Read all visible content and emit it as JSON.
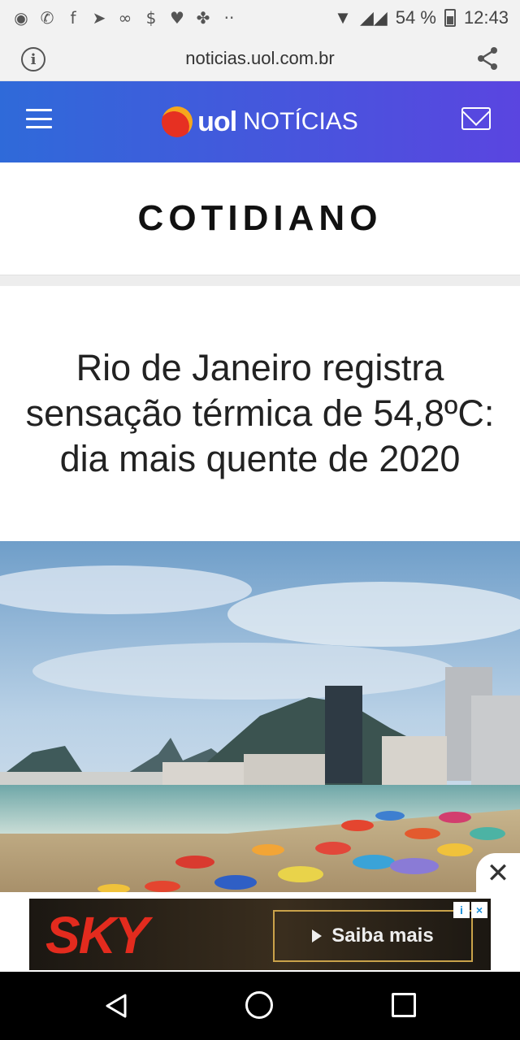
{
  "status_bar": {
    "notification_icons": [
      "chrome-icon",
      "whatsapp-icon",
      "facebook-icon",
      "telegram-icon",
      "cc-icon",
      "dollar-icon",
      "heart-icon",
      "puzzle-icon",
      "more-dots-icon"
    ],
    "battery": "54 %",
    "time": "12:43"
  },
  "url_bar": {
    "url": "noticias.uol.com.br"
  },
  "header": {
    "brand": "uol",
    "section": "NOTÍCIAS",
    "colors": {
      "gradient_start": "#2f6ad9",
      "gradient_end": "#5a45e0"
    }
  },
  "section": {
    "title": "COTIDIANO"
  },
  "article": {
    "headline": "Rio de Janeiro registra sensação térmica de 54,8ºC: dia mais quente de 2020"
  },
  "ad": {
    "logo": "SKY",
    "cta_label": "Saiba mais",
    "close": "✕"
  }
}
